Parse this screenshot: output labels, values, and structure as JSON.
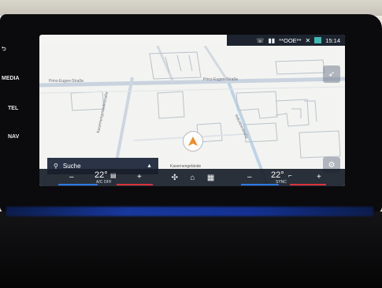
{
  "side_buttons": [
    {
      "label": "⮌"
    },
    {
      "label": "MEDIA"
    },
    {
      "label": "TEL"
    },
    {
      "label": "NAV"
    }
  ],
  "status": {
    "signal_text": "**OOE**",
    "time": "15:14"
  },
  "map": {
    "streets": {
      "prinz_eugen_left": "Prinz-Eugen-Straße",
      "prinz_eugen_right": "Prinz-Eugen-Straße",
      "vertical_left": "Kasernengelandestraße",
      "vertical_right": "Industriestraße",
      "bottom": "Kasernengelände"
    }
  },
  "search": {
    "label": "Suche"
  },
  "climate": {
    "left": {
      "minus": "–",
      "plus": "+",
      "temp": "22°",
      "sub": "A/C OFF"
    },
    "right": {
      "minus": "–",
      "plus": "+",
      "temp": "22°",
      "sub": "SYNC"
    }
  },
  "icons": {
    "compass": "compass-icon",
    "settings": "gear-icon",
    "fan": "fan-icon",
    "home": "home-icon",
    "apps": "apps-grid-icon"
  }
}
